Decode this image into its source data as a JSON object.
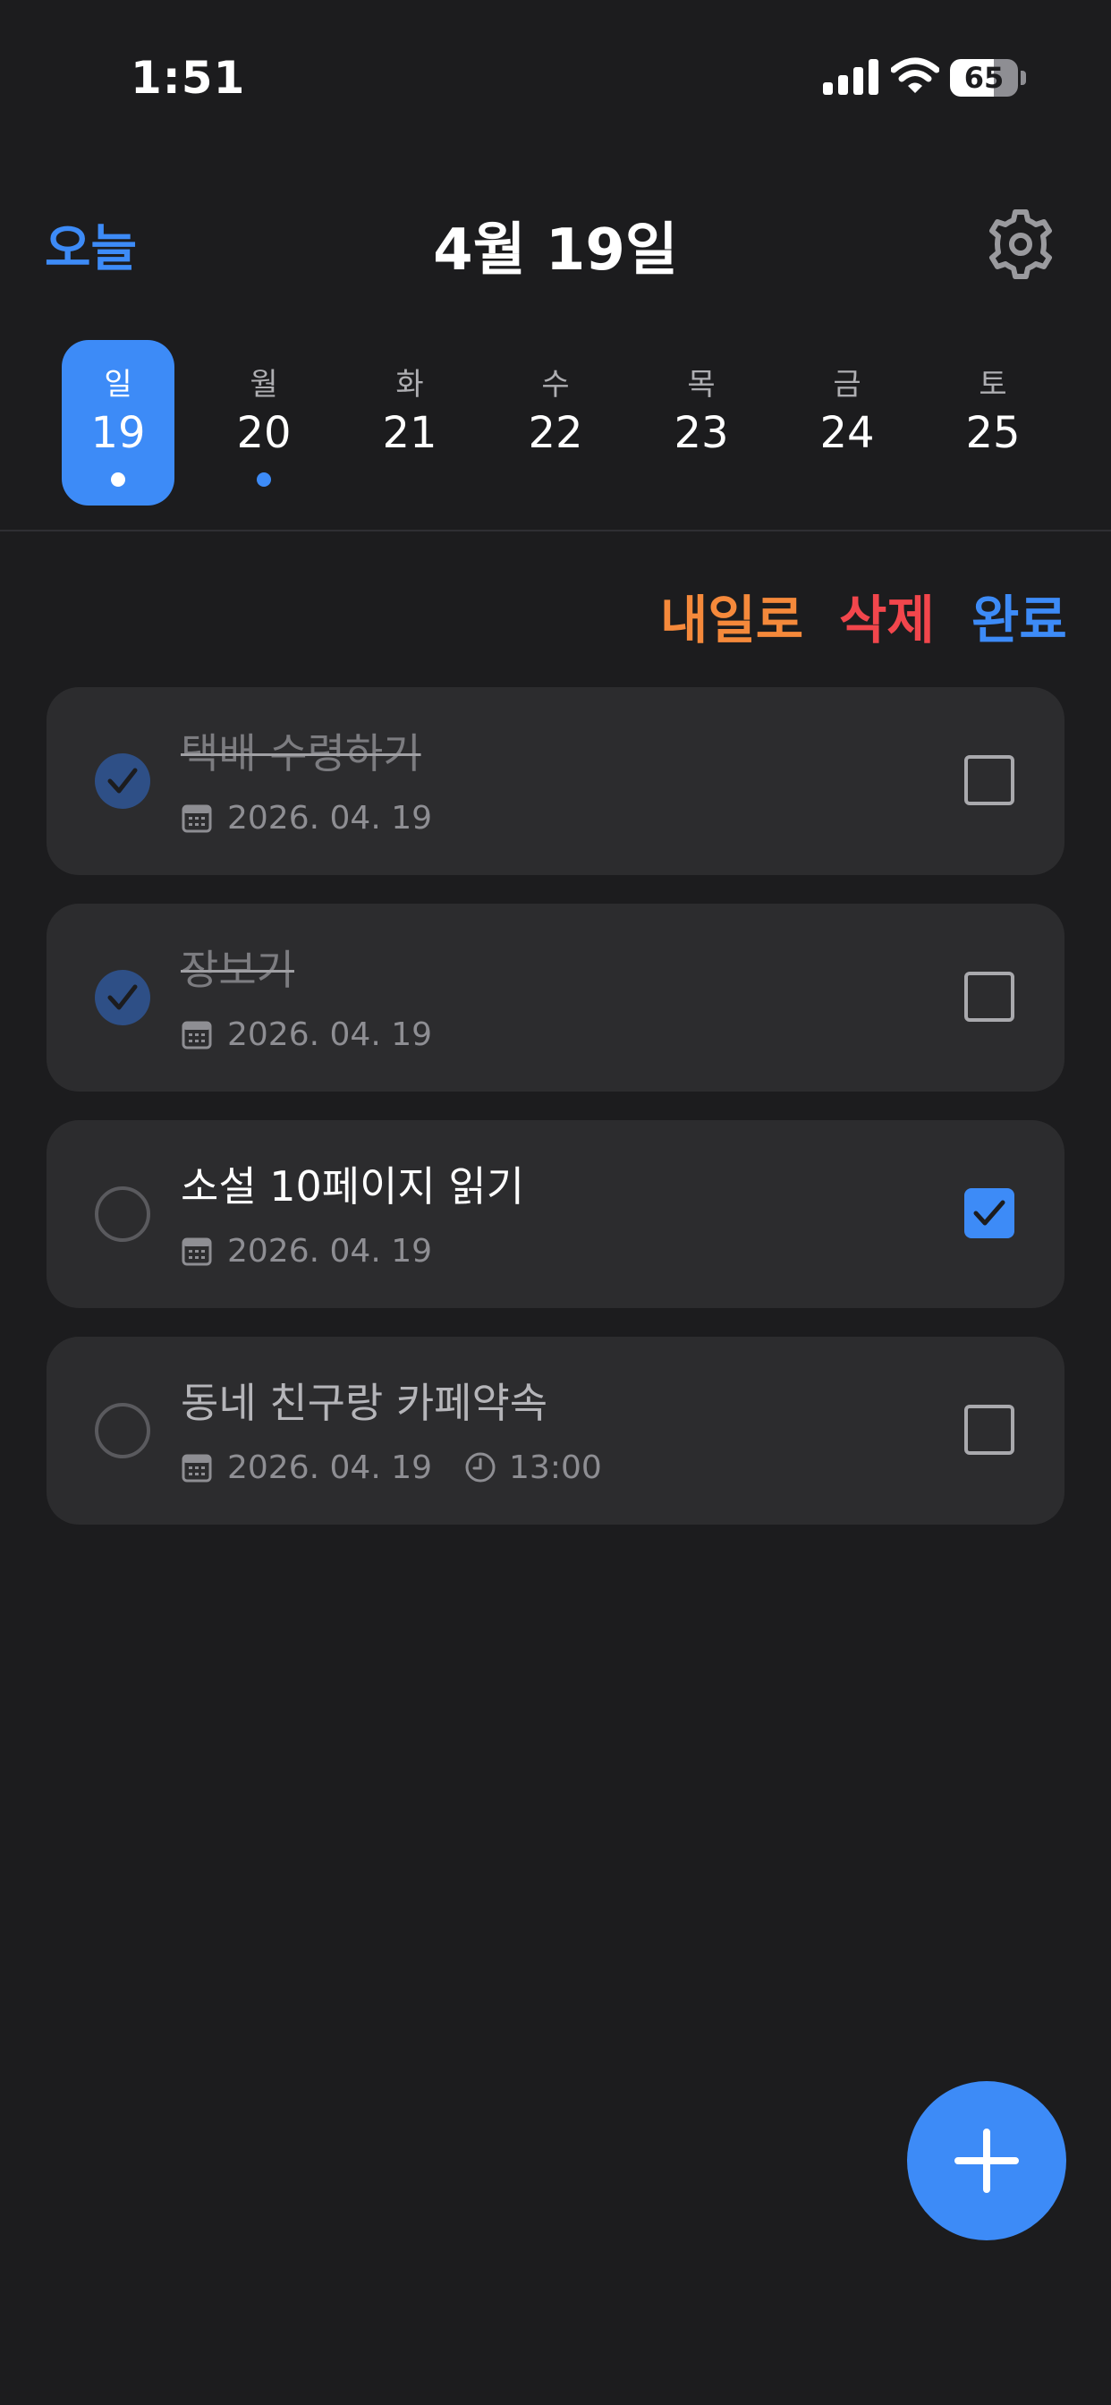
{
  "status_bar": {
    "time": "1:51",
    "battery_level": "65",
    "battery_fraction": 0.65
  },
  "header": {
    "today_label": "오늘",
    "title": "4월 19일"
  },
  "week": [
    {
      "name": "일",
      "num": "19",
      "selected": true,
      "dot": true
    },
    {
      "name": "월",
      "num": "20",
      "selected": false,
      "dot": true
    },
    {
      "name": "화",
      "num": "21",
      "selected": false,
      "dot": false
    },
    {
      "name": "수",
      "num": "22",
      "selected": false,
      "dot": false
    },
    {
      "name": "목",
      "num": "23",
      "selected": false,
      "dot": false
    },
    {
      "name": "금",
      "num": "24",
      "selected": false,
      "dot": false
    },
    {
      "name": "토",
      "num": "25",
      "selected": false,
      "dot": false
    }
  ],
  "actions": {
    "tomorrow": "내일로",
    "delete": "삭제",
    "done": "완료"
  },
  "tasks": [
    {
      "title": "택배 수령하기",
      "date": "2026. 04. 19",
      "time": "",
      "completed": true,
      "selected": false
    },
    {
      "title": "장보기",
      "date": "2026. 04. 19",
      "time": "",
      "completed": true,
      "selected": false
    },
    {
      "title": "소설 10페이지 읽기",
      "date": "2026. 04. 19",
      "time": "",
      "completed": false,
      "selected": true
    },
    {
      "title": "동네 친구랑 카페약속",
      "date": "2026. 04. 19",
      "time": "13:00",
      "completed": false,
      "selected": false
    }
  ],
  "colors": {
    "accent": "#3d8bf7",
    "orange": "#f5893b",
    "red": "#f2464c",
    "background": "#1c1c1e",
    "card": "#2c2c2e"
  },
  "icons": {
    "settings": "gear-icon",
    "add": "plus-icon",
    "date": "calendar-icon",
    "time": "clock-icon"
  }
}
